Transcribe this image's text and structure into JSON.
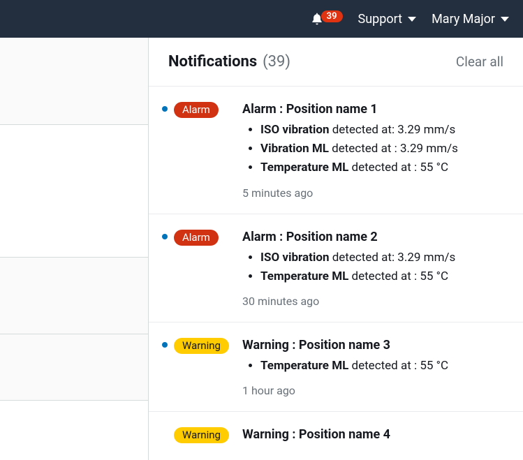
{
  "header": {
    "badge_count": "39",
    "support_label": "Support",
    "user_label": "Mary Major"
  },
  "panel": {
    "title": "Notifications",
    "count_display": "(39)",
    "clear_label": "Clear all"
  },
  "notifications": [
    {
      "badge_type": "alarm",
      "badge_label": "Alarm",
      "has_dot": true,
      "title": "Alarm : Position name 1",
      "details": [
        {
          "metric": "ISO vibration",
          "rest": " detected at: 3.29 mm/s"
        },
        {
          "metric": "Vibration ML",
          "rest": " detected at : 3.29 mm/s"
        },
        {
          "metric": "Temperature ML",
          "rest": " detected at : 55 °C"
        }
      ],
      "time": "5 minutes ago"
    },
    {
      "badge_type": "alarm",
      "badge_label": "Alarm",
      "has_dot": true,
      "title": "Alarm : Position name 2",
      "details": [
        {
          "metric": "ISO vibration",
          "rest": " detected at: 3.29 mm/s"
        },
        {
          "metric": "Temperature ML",
          "rest": " detected at : 55 °C"
        }
      ],
      "time": "30 minutes ago"
    },
    {
      "badge_type": "warning",
      "badge_label": "Warning",
      "has_dot": true,
      "title": "Warning : Position name 3",
      "details": [
        {
          "metric": "Temperature ML",
          "rest": " detected at : 55 °C"
        }
      ],
      "time": "1 hour ago"
    },
    {
      "badge_type": "warning",
      "badge_label": "Warning",
      "has_dot": false,
      "title": "Warning : Position name 4",
      "details": [],
      "time": ""
    }
  ]
}
